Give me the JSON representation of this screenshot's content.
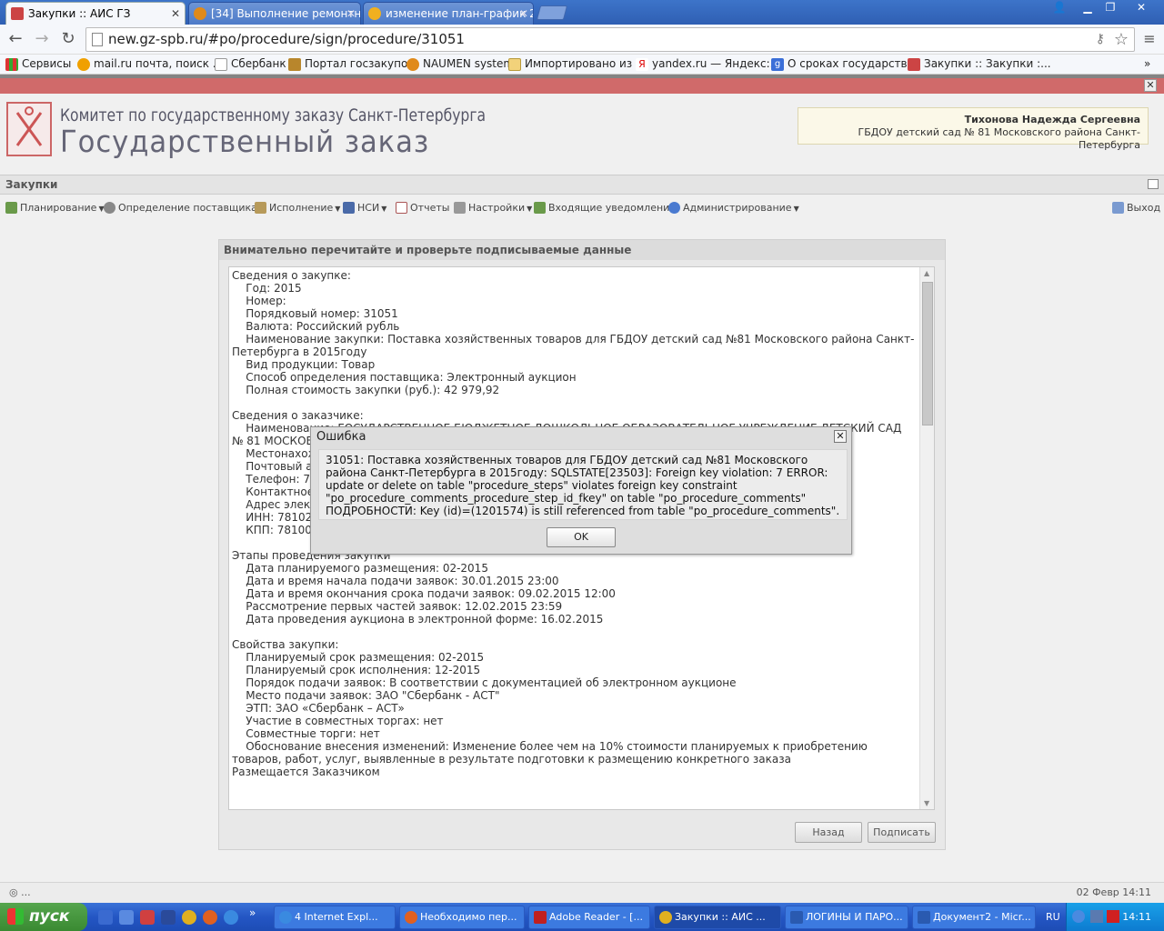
{
  "browser": {
    "tabs": [
      {
        "label": "Закупки :: АИС ГЗ",
        "icon": "gz-icon",
        "active": true
      },
      {
        "label": "[34] Выполнение ремонтны",
        "icon": "naumen-icon",
        "active": false
      },
      {
        "label": "изменение план-график 28",
        "icon": "mail-icon",
        "active": false
      }
    ],
    "address": "new.gz-spb.ru/#po/procedure/sign/procedure/31051",
    "bookmarks": [
      "Сервисы",
      "mail.ru почта, поиск ...",
      "Сбербанк",
      "Портал госзакупок",
      "NAUMEN system",
      "Импортировано из IE",
      "yandex.ru — Яндекс:...",
      "О сроках государств...",
      "Закупки :: Закупки :..."
    ],
    "bookmarks_more": "»"
  },
  "header": {
    "org_line1": "Комитет по государственному заказу Санкт-Петербурга",
    "org_line2": "Государственный заказ",
    "user_name": "Тихонова Надежда Сергеевна",
    "user_org": "ГБДОУ детский сад № 81 Московского района Санкт-Петербурга"
  },
  "app": {
    "section_title": "Закупки",
    "menu": [
      "Планирование",
      "Определение поставщика",
      "Исполнение",
      "НСИ",
      "Отчеты",
      "Настройки",
      "Входящие уведомления",
      "Администрирование"
    ],
    "logout": "Выход"
  },
  "panel": {
    "title": "Внимательно перечитайте и проверьте подписываемые данные",
    "content": "Сведения о закупке:\n    Год: 2015\n    Номер:\n    Порядковый номер: 31051\n    Валюта: Российский рубль\n    Наименование закупки: Поставка хозяйственных товаров для ГБДОУ детский сад №81 Московского района Санкт-Петербурга в 2015году\n    Вид продукции: Товар\n    Способ определения поставщика: Электронный аукцион\n    Полная стоимость закупки (руб.): 42 979,92\n\nСведения о заказчике:\n    Наименование: ГОСУДАРСТВЕННОЕ БЮДЖЕТНОЕ ДОШКОЛЬНОЕ ОБРАЗОВАТЕЛЬНОЕ УЧРЕЖДЕНИЕ ДЕТСКИЙ САД № 81 МОСКОВСКОГО РАЙОНА САНКТ-ПЕТЕРБУРГА\n    Местонахождение: 196135, Санкт-Петербург, УЛ. ГАСТЕЛЛО, Д. 22, ЛИТ. А, ПОМ. 23 Н. 26-Н. 29-Н. 1-Й\n    Почтовый адрес: 196135, Санкт-Петербург, УЛ. ГАСТЕЛЛО, Д. 22, ЛИТ. А, ПОМ. 23 Н. 26-Н. 29-Н. 1-Й\n    Телефон: 7-8\n    Контактное лицо:\n    Адрес электронной почты:\n    ИНН: 7810214\n    КПП: 781001001\n\nЭтапы проведения закупки\n    Дата планируемого размещения: 02-2015\n    Дата и время начала подачи заявок: 30.01.2015 23:00\n    Дата и время окончания срока подачи заявок: 09.02.2015 12:00\n    Рассмотрение первых частей заявок: 12.02.2015 23:59\n    Дата проведения аукциона в электронной форме: 16.02.2015\n\nСвойства закупки:\n    Планируемый срок размещения: 02-2015\n    Планируемый срок исполнения: 12-2015\n    Порядок подачи заявок: В соответствии с документацией об электронном аукционе\n    Место подачи заявок: ЗАО \"Сбербанк - АСТ\"\n    ЭТП: ЗАО «Сбербанк – АСТ»\n    Участие в совместных торгах: нет\n    Совместные торги: нет\n    Обоснование внесения изменений: Изменение более чем на 10% стоимости планируемых к приобретению товаров, работ, услуг, выявленные в результате подготовки к размещению конкретного заказа\nРазмещается Заказчиком",
    "back_label": "Назад",
    "sign_label": "Подписать"
  },
  "dialog": {
    "title": "Ошибка",
    "message": "31051: Поставка хозяйственных товаров для ГБДОУ детский сад №81 Московского района Санкт-Петербурга в 2015году: SQLSTATE[23503]: Foreign key violation: 7 ERROR: update or delete on table \"procedure_steps\" violates foreign key constraint \"po_procedure_comments_procedure_step_id_fkey\" on table \"po_procedure_comments\" ПОДРОБНОСТИ: Key (id)=(1201574) is still referenced from table \"po_procedure_comments\".",
    "ok_label": "OK",
    "close_glyph": "✕"
  },
  "statusbar": {
    "left": "◎ ...",
    "right": "02 Февр 14:11"
  },
  "taskbar": {
    "start_label": "пуск",
    "tasks": [
      "4 Internet Expl...",
      "Необходимо пер...",
      "Adobe Reader - [...",
      "Закупки :: АИС ...",
      "ЛОГИНЫ И ПАРО...",
      "Документ2 - Micr..."
    ],
    "lang": "RU",
    "clock": "14:11"
  }
}
